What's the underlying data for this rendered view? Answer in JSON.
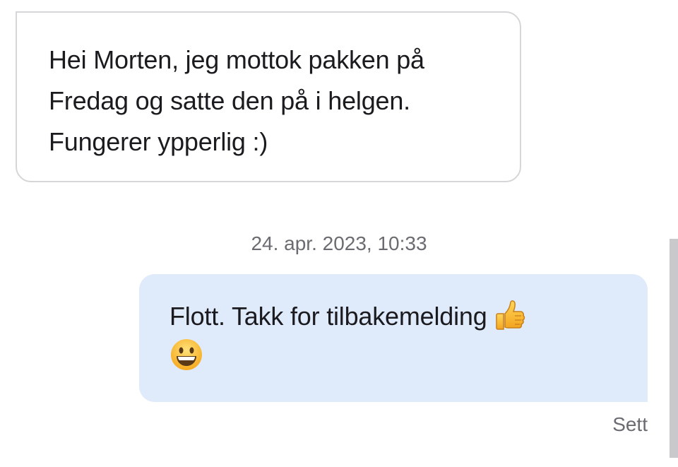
{
  "messages": [
    {
      "direction": "incoming",
      "text": "Hei Morten, jeg mottok pakken på\nFredag og satte den på i helgen.\nFungerer ypperlig :)"
    },
    {
      "direction": "outgoing",
      "timestamp": "24. apr. 2023, 10:33",
      "text": "Flott. Takk for tilbakemelding",
      "emojis": [
        "thumbs-up-emoji",
        "grinning-face-emoji"
      ],
      "status": "Sett"
    }
  ],
  "colors": {
    "incoming_border": "#d6d6d9",
    "outgoing_background": "#dfeafb",
    "meta_text": "#6b6b71",
    "scrollbar": "#c9c9cc"
  }
}
